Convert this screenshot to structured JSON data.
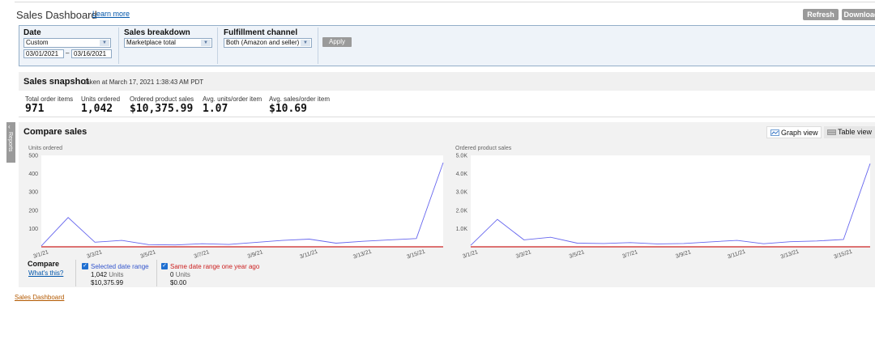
{
  "header": {
    "title": "Sales Dashboard",
    "learn_more": "Learn more",
    "refresh": "Refresh",
    "download": "Download"
  },
  "filters": {
    "date": {
      "label": "Date",
      "selected": "Custom",
      "from": "03/01/2021",
      "dash": "–",
      "to": "03/16/2021"
    },
    "sales_breakdown": {
      "label": "Sales breakdown",
      "selected": "Marketplace total"
    },
    "fulfillment_channel": {
      "label": "Fulfillment channel",
      "selected": "Both (Amazon and seller)"
    },
    "apply": "Apply"
  },
  "snapshot": {
    "title": "Sales snapshot",
    "taken": "taken at March 17, 2021 1:38:43 AM PDT",
    "metrics": [
      {
        "label": "Total order items",
        "value": "971"
      },
      {
        "label": "Units ordered",
        "value": "1,042"
      },
      {
        "label": "Ordered product sales",
        "value": "$10,375.99"
      },
      {
        "label": "Avg. units/order item",
        "value": "1.07"
      },
      {
        "label": "Avg. sales/order item",
        "value": "$10.69"
      }
    ]
  },
  "sidebar_tab": {
    "chevron": "‹",
    "label": "Reports"
  },
  "compare": {
    "title": "Compare sales",
    "graph_view": "Graph view",
    "table_view": "Table view",
    "legend": {
      "compare_label": "Compare",
      "whats_this": "What's this?",
      "selected": {
        "label": "Selected date range",
        "units": "1,042",
        "units_suffix": "Units",
        "sales": "$10,375.99",
        "color": "#3355cc"
      },
      "last_year": {
        "label": "Same date range one year ago",
        "units": "0",
        "units_suffix": "Units",
        "sales": "$0.00",
        "color": "#cc2222"
      }
    }
  },
  "chart_data": [
    {
      "type": "line",
      "ylabel": "Units ordered",
      "ylim": [
        0,
        500
      ],
      "yticks": [
        "500",
        "400",
        "300",
        "200",
        "100"
      ],
      "x": [
        "3/1/21",
        "3/2/21",
        "3/3/21",
        "3/4/21",
        "3/5/21",
        "3/6/21",
        "3/7/21",
        "3/8/21",
        "3/9/21",
        "3/10/21",
        "3/11/21",
        "3/12/21",
        "3/13/21",
        "3/14/21",
        "3/15/21",
        "3/16/21"
      ],
      "xticks": [
        "3/1/21",
        "3/3/21",
        "3/5/21",
        "3/7/21",
        "3/9/21",
        "3/11/21",
        "3/13/21",
        "3/15/21"
      ],
      "series": [
        {
          "values": [
            5,
            160,
            25,
            35,
            12,
            10,
            17,
            13,
            24,
            35,
            42,
            20,
            30,
            38,
            45,
            460
          ],
          "color": "#6666ee"
        },
        {
          "values": [
            0,
            0,
            0,
            0,
            0,
            0,
            0,
            0,
            0,
            0,
            0,
            0,
            0,
            0,
            0,
            0
          ],
          "color": "#cc2222"
        }
      ]
    },
    {
      "type": "line",
      "ylabel": "Ordered product sales",
      "ylim": [
        0,
        5000
      ],
      "yticks": [
        "5.0K",
        "4.0K",
        "3.0K",
        "2.0K",
        "1.0K"
      ],
      "x": [
        "3/1/21",
        "3/2/21",
        "3/3/21",
        "3/4/21",
        "3/5/21",
        "3/6/21",
        "3/7/21",
        "3/8/21",
        "3/9/21",
        "3/10/21",
        "3/11/21",
        "3/12/21",
        "3/13/21",
        "3/14/21",
        "3/15/21",
        "3/16/21"
      ],
      "xticks": [
        "3/1/21",
        "3/3/21",
        "3/5/21",
        "3/7/21",
        "3/9/21",
        "3/11/21",
        "3/13/21",
        "3/15/21"
      ],
      "series": [
        {
          "values": [
            80,
            1500,
            380,
            520,
            200,
            180,
            230,
            160,
            180,
            270,
            350,
            170,
            280,
            320,
            400,
            4550
          ],
          "color": "#6666ee"
        },
        {
          "values": [
            0,
            0,
            0,
            0,
            0,
            0,
            0,
            0,
            0,
            0,
            0,
            0,
            0,
            0,
            0,
            0
          ],
          "color": "#cc2222"
        }
      ]
    }
  ],
  "footer": {
    "link": "Sales Dashboard"
  }
}
